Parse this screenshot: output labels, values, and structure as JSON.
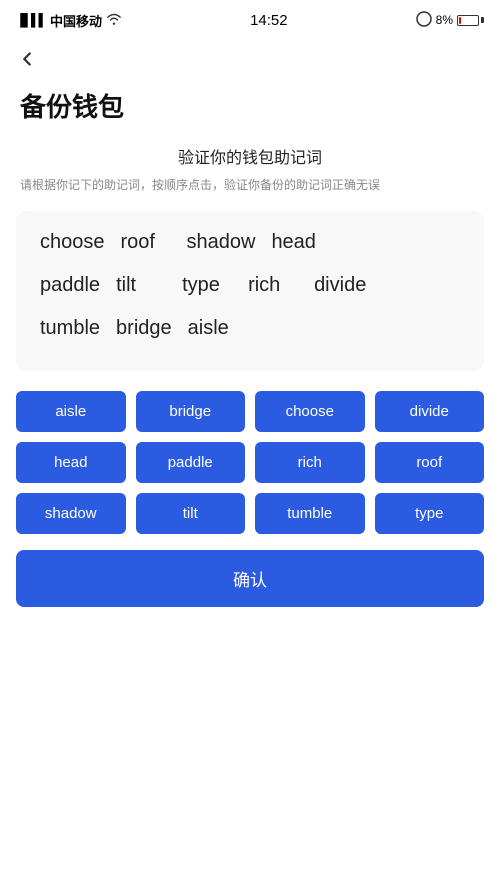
{
  "statusBar": {
    "carrier": "中国移动",
    "time": "14:52",
    "batteryPercent": "8%",
    "batteryColor": "#e00000"
  },
  "header": {
    "back": "‹",
    "title": "备份钱包"
  },
  "instruction": {
    "title": "验证你的钱包助记词",
    "desc": "请根据你记下的助记词，按顺序点击，验证你备份的助记词正确无误"
  },
  "wordDisplayRows": [
    [
      "choose",
      "roof",
      "shadow",
      "head"
    ],
    [
      "paddle",
      "tilt",
      "type",
      "rich",
      "divide"
    ],
    [
      "tumble",
      "bridge",
      "aisle"
    ]
  ],
  "wordButtons": [
    "aisle",
    "bridge",
    "choose",
    "divide",
    "head",
    "paddle",
    "rich",
    "roof",
    "shadow",
    "tilt",
    "tumble",
    "type"
  ],
  "confirmButton": "确认"
}
